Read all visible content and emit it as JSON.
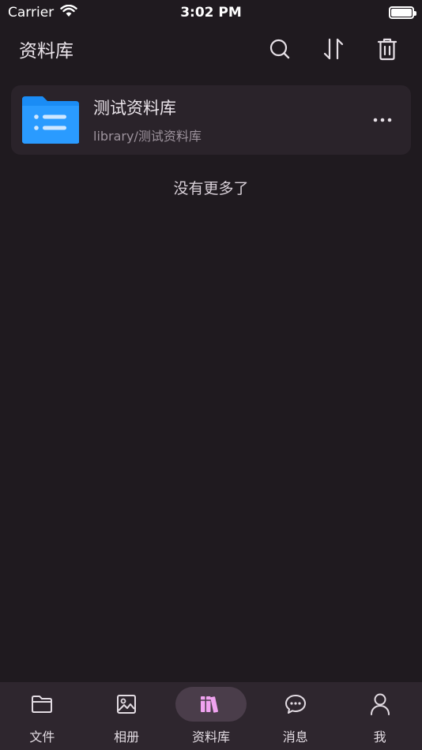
{
  "status_bar": {
    "carrier": "Carrier",
    "time": "3:02 PM"
  },
  "header": {
    "title": "资料库",
    "actions": [
      "search-icon",
      "sort-icon",
      "trash-icon"
    ]
  },
  "libraries": [
    {
      "name": "测试资料库",
      "path": "library/测试资料库",
      "icon": "folder-list-icon"
    }
  ],
  "list_end_text": "没有更多了",
  "bottom_nav": {
    "active_index": 2,
    "items": [
      {
        "label": "文件",
        "icon": "folder-icon"
      },
      {
        "label": "相册",
        "icon": "image-icon"
      },
      {
        "label": "资料库",
        "icon": "books-icon"
      },
      {
        "label": "消息",
        "icon": "chat-icon"
      },
      {
        "label": "我",
        "icon": "person-icon"
      }
    ]
  },
  "colors": {
    "background": "#1f1a1f",
    "card": "#2a232a",
    "nav_background": "#2e262e",
    "folder_blue": "#1a8cf5",
    "accent_pink": "#f0a3f0"
  }
}
